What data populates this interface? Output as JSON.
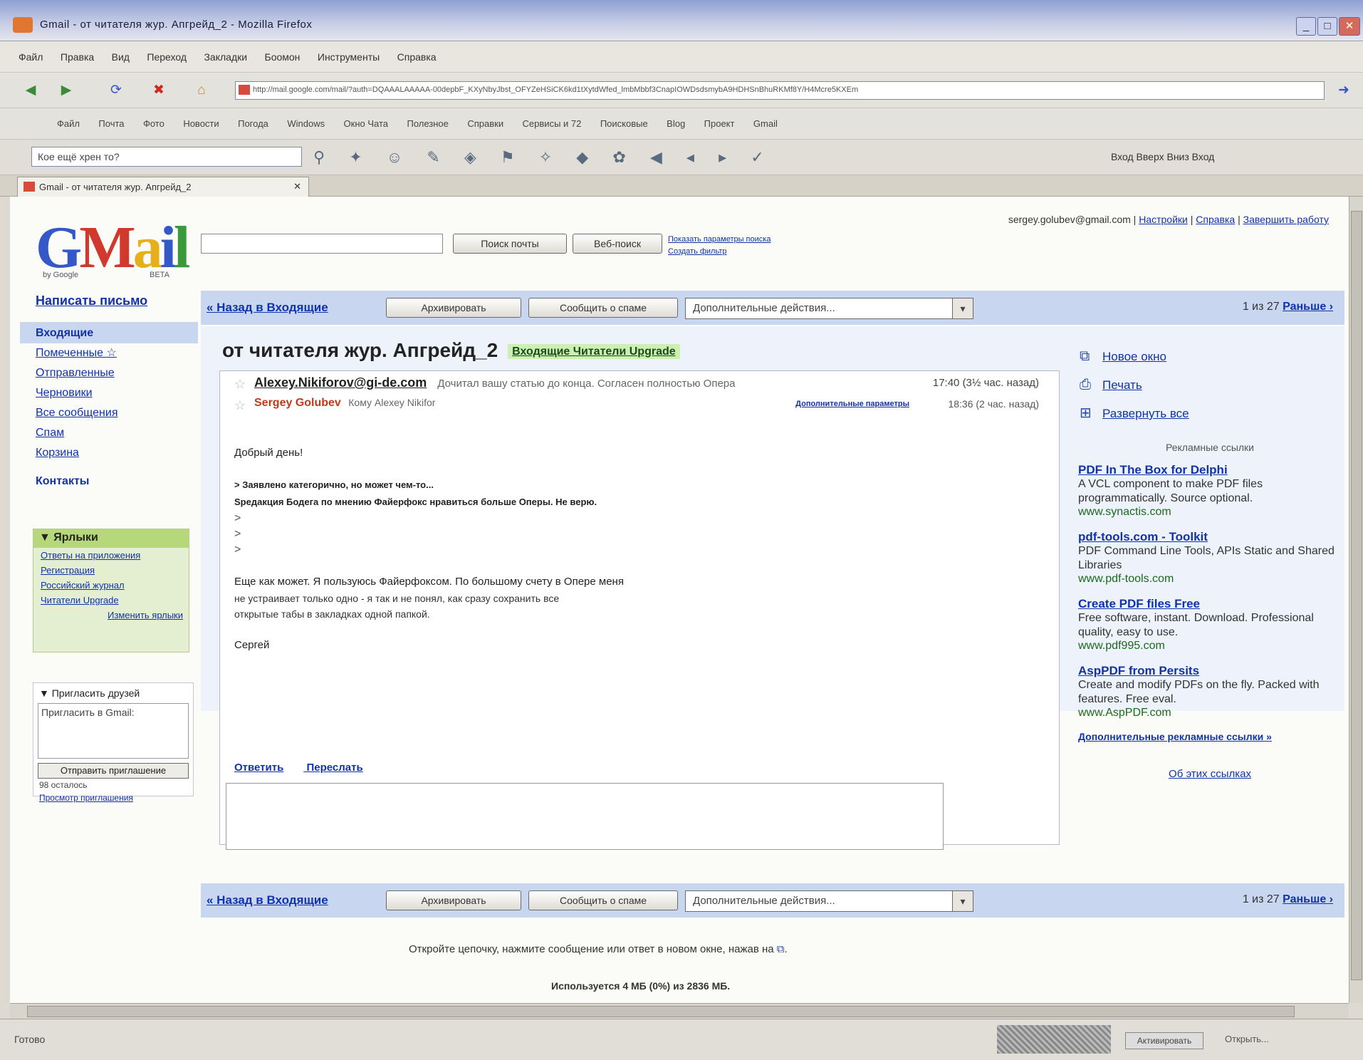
{
  "window": {
    "title": "Gmail - от читателя жур. Апгрейд_2 - Mozilla Firefox",
    "controls": [
      "_",
      "□",
      "✕"
    ]
  },
  "menu": [
    "Файл",
    "Правка",
    "Вид",
    "Переход",
    "Закладки",
    "Боомон",
    "Инструменты",
    "Справка"
  ],
  "nav": {
    "url": "http://mail.google.com/mail/?auth=DQAAALAAAAA-00depbF_KXyNbyJbst_OFYZeHSiCK6kd1tXytdWfed_lmbMbbf3CnapIOWDsdsmybA9HDHSnBhuRKMf8Y/H4Mcre5KXEm"
  },
  "bookmarks": [
    "Файл",
    "Почта",
    "Фото",
    "Новости",
    "Погода",
    "Windows",
    "Окно Чата",
    "Полезное",
    "Справки",
    "Сервисы и 72",
    "Поисковые",
    "Blog",
    "Проект",
    "Gmail"
  ],
  "toolbar": {
    "search_value": "Кое ещё хрен то?",
    "extra": "Вход Вверх Вниз Вход"
  },
  "tab": {
    "label": "Gmail - от читателя жур. Апгрейд_2"
  },
  "gmail": {
    "logo_g": "G",
    "logo_m": "M",
    "logo_a": "a",
    "logo_i": "i",
    "logo_l": "l",
    "logo_sub": "by Google",
    "logo_beta": "BETA",
    "search_mail_label": "Поиск почты",
    "search_web_label": "Веб-поиск",
    "small_links": [
      "Показать параметры поиска",
      "Создать фильтр"
    ],
    "account_email": "sergey.golubev@gmail.com",
    "top_links": [
      "Настройки",
      "Справка",
      "Завершить работу"
    ],
    "compose_label": "Написать письмо",
    "nav_items": [
      "Входящие",
      "Помеченные ☆",
      "Отправленные",
      "Черновики",
      "Все сообщения",
      "Спам",
      "Корзина",
      "Контакты"
    ],
    "labels_title": "▼ Ярлыки",
    "labels": [
      "Ответы на приложения",
      "Регистрация",
      "Российский журнал",
      "Читатели Upgrade"
    ],
    "labels_edit": "Изменить ярлыки",
    "invite_title": "▼ Пригласить друзей",
    "invite_placeholder": "Пригласить в Gmail:",
    "invite_send": "Отправить приглашение",
    "invite_left": "98 осталось",
    "invite_preview": "Просмотр приглашения"
  },
  "actions": {
    "back_label": "« Назад в Входящие",
    "archive_label": "Архивировать",
    "spam_label": "Сообщить о спаме",
    "more_actions": "Дополнительные действия...",
    "dropdown_glyph": "▾",
    "page_info": "1 из 27",
    "older_label": "Раньше ›"
  },
  "message": {
    "subject": "от читателя жур. Апгрейд_2",
    "label_tag": "Входящие Читатели Upgrade",
    "sender1": "Alexey.Nikiforov@gi-de.com",
    "snippet1": "Дочитал вашу статью до конца. Согласен полностью Опера",
    "time1": "17:40 (3½ час. назад)",
    "sender2": "Sergey Golubev",
    "to2": "Кому Alexey Nikifor",
    "options2": "Дополнительные параметры",
    "time2": "18:36 (2 час. назад)",
    "greeting": "Добрый день!",
    "quote1": "> Заявлено категорично, но может чем-то...",
    "quote2": "Sредакция Бодега по мнению Файерфокс нравиться больше Оперы. Не верю.",
    "gt1": ">",
    "gt2": ">",
    "gt3": ">",
    "para_line1": "Еще как может. Я пользуюсь Файерфоксом. По большому счету в Опере меня",
    "para_line2": "не устраивает только одно - я так и не понял, как сразу сохранить все",
    "para_line3": "открытые табы в закладках одной папкой.",
    "signature": "Сергей",
    "reply_label": "Ответить",
    "forward_label": "Переслать"
  },
  "right_panel": {
    "new_window": "Новое окно",
    "print": "Печать",
    "expand_all": "Развернуть все",
    "ads_heading": "Рекламные ссылки",
    "ads": [
      {
        "title": "PDF In The Box for Delphi",
        "desc": "A VCL component to make PDF files programmatically. Source optional.",
        "url": "www.synactis.com"
      },
      {
        "title": "pdf-tools.com - Toolkit",
        "desc": "PDF Command Line Tools, APIs Static and Shared Libraries",
        "url": "www.pdf-tools.com"
      },
      {
        "title": "Create PDF files Free",
        "desc": "Free software, instant. Download. Professional quality, easy to use.",
        "url": "www.pdf995.com"
      },
      {
        "title": "AspPDF from Persits",
        "desc": "Create and modify PDFs on the fly. Packed with features. Free eval.",
        "url": "www.AspPDF.com"
      }
    ],
    "more_links": "Дополнительные рекламные ссылки »",
    "about_links": "Об этих ссылках"
  },
  "footer": {
    "tip": "Откройте цепочку, нажмите сообщение или ответ в новом окне, нажав на",
    "usage": "Используется 4 МБ (0%) из 2836 МБ."
  },
  "status": {
    "text": "Готово",
    "button": "Активировать",
    "right": "Открыть..."
  }
}
